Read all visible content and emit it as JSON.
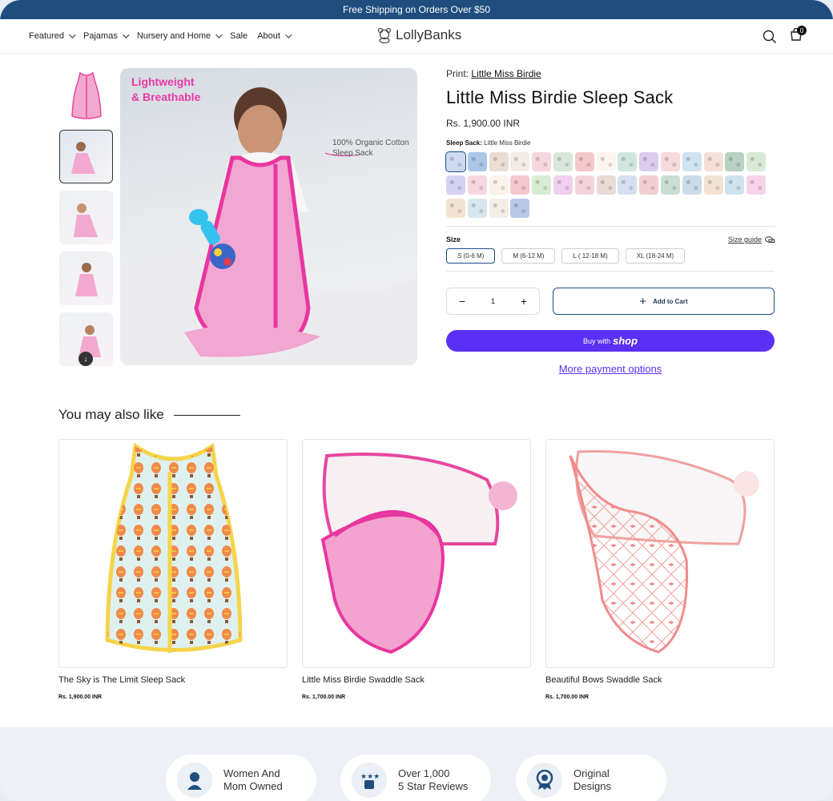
{
  "announcement": "Free Shipping on Orders Over $50",
  "nav": [
    {
      "label": "Featured",
      "dropdown": true
    },
    {
      "label": "Pajamas",
      "dropdown": true
    },
    {
      "label": "Nursery and Home",
      "dropdown": true
    },
    {
      "label": "Sale",
      "dropdown": false
    },
    {
      "label": "About",
      "dropdown": true
    }
  ],
  "logo": "LollyBanks",
  "cart_count": "0",
  "gallery": {
    "overlay_title_1": "Lightweight",
    "overlay_title_2": "& Breathable",
    "overlay_note_1": "100% Organic Cotton",
    "overlay_note_2": "Sleep Sack"
  },
  "product": {
    "print_prefix": "Print:",
    "print_name": "Little Miss Birdie",
    "title": "Little Miss Birdie Sleep Sack",
    "price": "Rs. 1,900.00 INR",
    "variant_label": "Sleep Sack:",
    "variant_value": "Little Miss Birdie",
    "size_label": "Size",
    "size_guide": "Size guide",
    "sizes": [
      "S (0-6 M)",
      "M (6-12 M)",
      "L ( 12-18 M)",
      "XL (18-24 M)"
    ],
    "selected_size": "S (0-6 M)",
    "quantity": "1",
    "add_to_cart": "Add to Cart",
    "buy_with": "Buy with",
    "shop": "shop",
    "more_payment": "More payment options"
  },
  "swatch_colors": [
    "#cfd9f2",
    "#a9c6e8",
    "#e9ddd4",
    "#f2ebe6",
    "#f7d7df",
    "#d9e6d9",
    "#f3c9cc",
    "#faf6ef",
    "#cfe6df",
    "#dcccee",
    "#f6dadd",
    "#cfe4f0",
    "#f3e1d8",
    "#b8d1c3",
    "#d7ead6",
    "#d6d2f3",
    "#f8d6e0",
    "#faf3ea",
    "#f4c8ce",
    "#d8ecd3",
    "#f0d0ee",
    "#f4d4dc",
    "#eadbd5",
    "#d4e0ef",
    "#f2cfd4",
    "#c8dfd4",
    "#cadcec",
    "#f3e3d3",
    "#cfe3ee",
    "#f7d4ea",
    "#f2e4d2",
    "#d6e6ef",
    "#f4efe6",
    "#b9c8e6"
  ],
  "recommended": {
    "title": "You may also like",
    "items": [
      {
        "name": "The Sky is The Limit Sleep Sack",
        "price": "Rs. 1,900.00 INR"
      },
      {
        "name": "Little Miss Birdie Swaddle Sack",
        "price": "Rs. 1,700.00 INR"
      },
      {
        "name": "Beautiful Bows Swaddle Sack",
        "price": "Rs. 1,700.00 INR"
      }
    ]
  },
  "trust": [
    {
      "line1": "Women And",
      "line2": "Mom Owned",
      "icon": "woman-icon"
    },
    {
      "line1": "Over 1,000",
      "line2": "5 Star Reviews",
      "icon": "stars-icon"
    },
    {
      "line1": "Original",
      "line2": "Designs",
      "icon": "badge-icon"
    }
  ]
}
